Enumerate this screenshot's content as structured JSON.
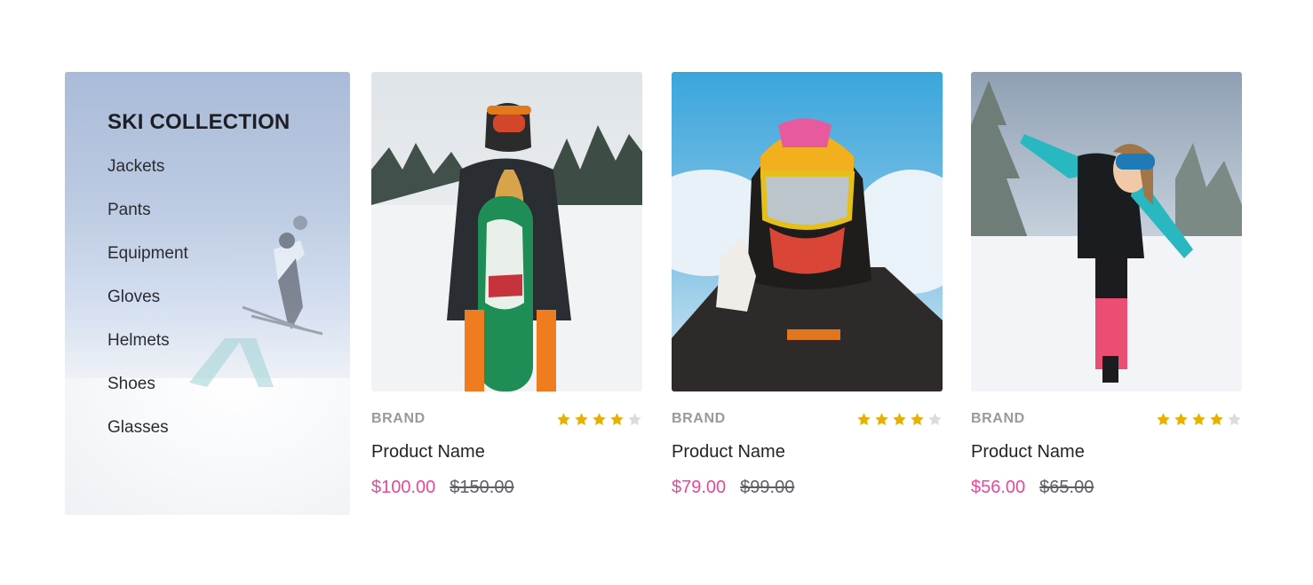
{
  "collection": {
    "title": "SKI COLLECTION",
    "categories": [
      "Jackets",
      "Pants",
      "Equipment",
      "Gloves",
      "Helmets",
      "Shoes",
      "Glasses"
    ]
  },
  "colors": {
    "price_accent": "#e8489a",
    "star_filled": "#e6b100",
    "star_empty": "#dcdcdc"
  },
  "products": [
    {
      "brand": "BRAND",
      "name": "Product Name",
      "price": "$100.00",
      "old_price": "$150.00",
      "rating": 4,
      "rating_max": 5,
      "image": "snowboarder-with-board-photo"
    },
    {
      "brand": "BRAND",
      "name": "Product Name",
      "price": "$79.00",
      "old_price": "$99.00",
      "rating": 4,
      "rating_max": 5,
      "image": "helmet-goggles-selfie-photo"
    },
    {
      "brand": "BRAND",
      "name": "Product Name",
      "price": "$56.00",
      "old_price": "$65.00",
      "rating": 4,
      "rating_max": 5,
      "image": "skier-in-snow-photo"
    }
  ]
}
